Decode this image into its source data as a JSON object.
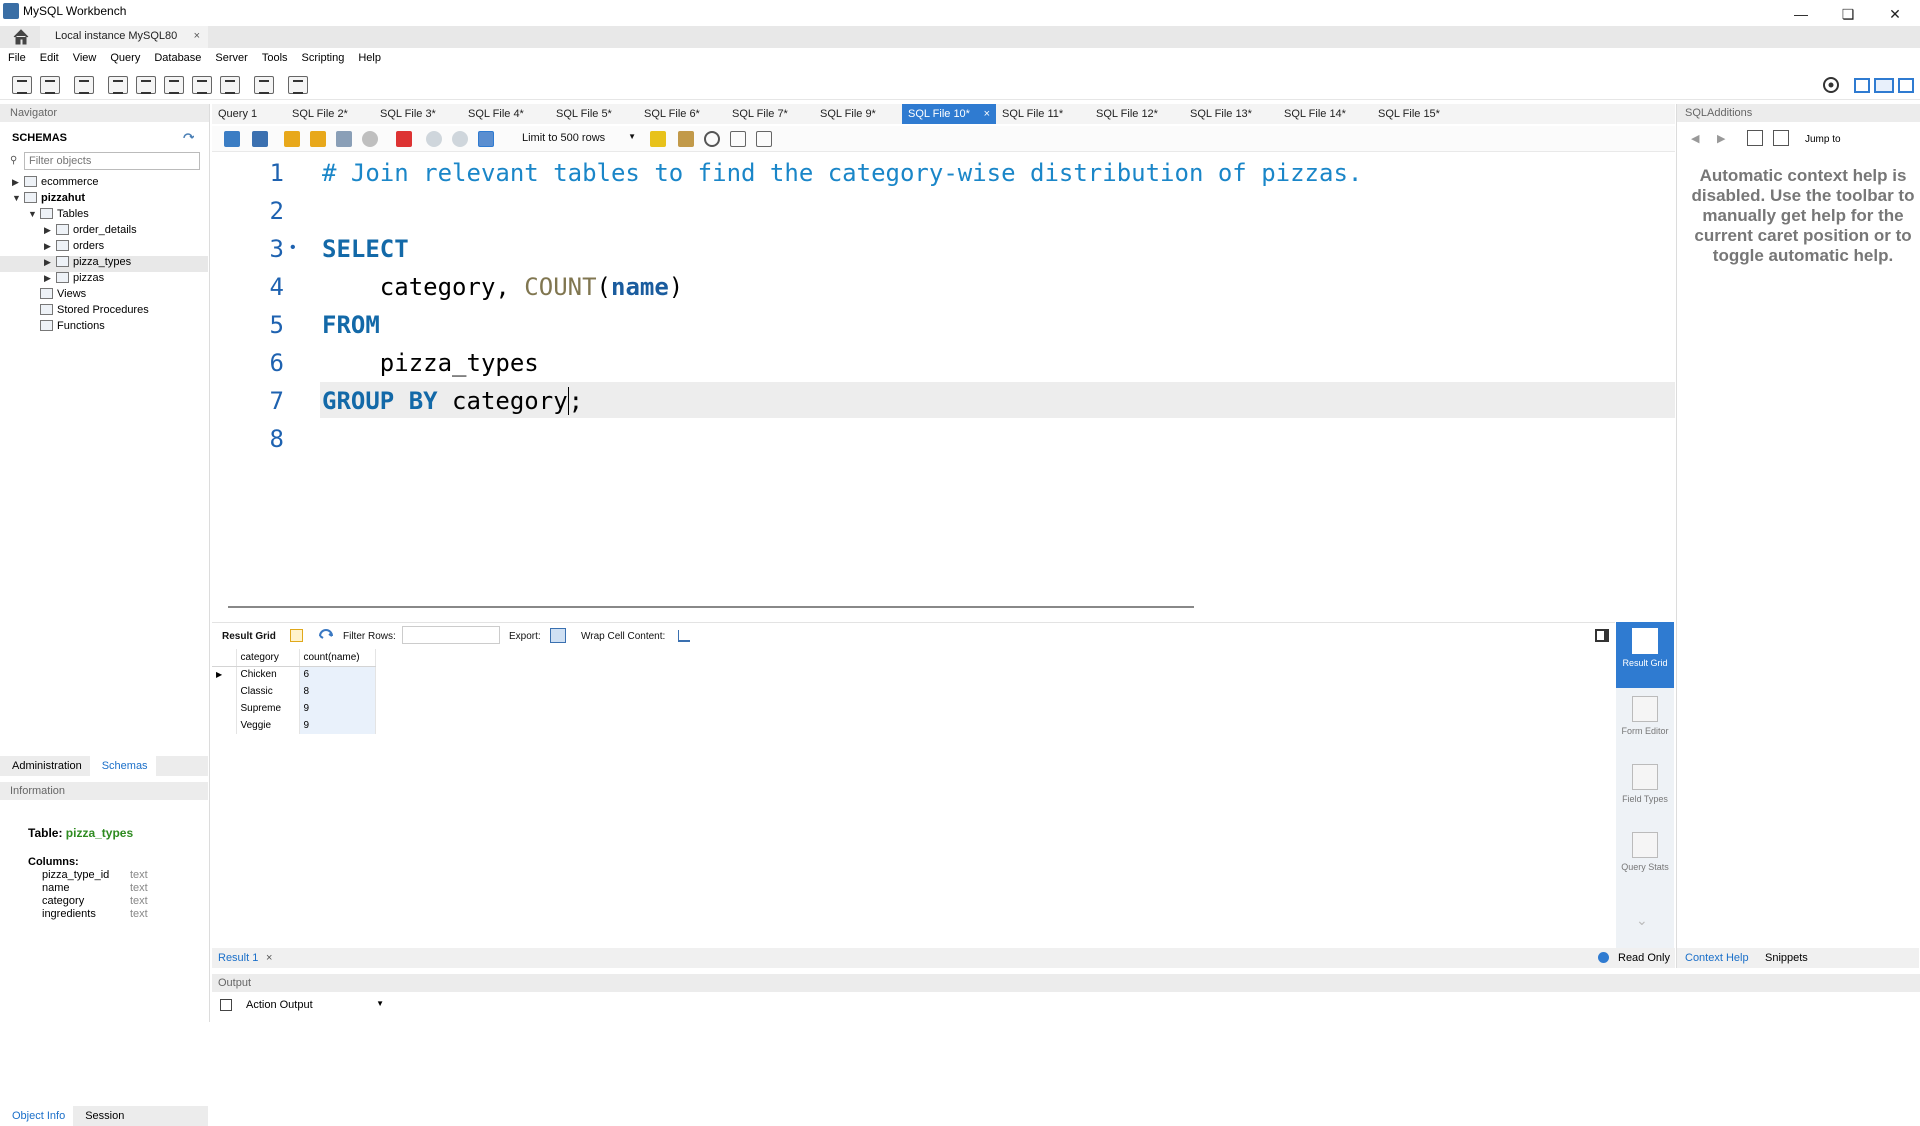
{
  "window": {
    "title": "MySQL Workbench",
    "minimize": "—",
    "restore": "❏",
    "close": "✕"
  },
  "connection_tab": {
    "label": "Local instance MySQL80",
    "close": "×"
  },
  "menu": [
    "File",
    "Edit",
    "View",
    "Query",
    "Database",
    "Server",
    "Tools",
    "Scripting",
    "Help"
  ],
  "navigator": {
    "header": "Navigator",
    "schemas_label": "SCHEMAS",
    "filter_placeholder": "Filter objects",
    "tree": [
      {
        "label": "ecommerce",
        "level": 0,
        "arrow": "▶",
        "bold": false
      },
      {
        "label": "pizzahut",
        "level": 0,
        "arrow": "▼",
        "bold": true
      },
      {
        "label": "Tables",
        "level": 1,
        "arrow": "▼",
        "bold": false
      },
      {
        "label": "order_details",
        "level": 2,
        "arrow": "▶",
        "bold": false
      },
      {
        "label": "orders",
        "level": 2,
        "arrow": "▶",
        "bold": false
      },
      {
        "label": "pizza_types",
        "level": 2,
        "arrow": "▶",
        "bold": false,
        "selected": true
      },
      {
        "label": "pizzas",
        "level": 2,
        "arrow": "▶",
        "bold": false
      },
      {
        "label": "Views",
        "level": 1,
        "arrow": "",
        "bold": false
      },
      {
        "label": "Stored Procedures",
        "level": 1,
        "arrow": "",
        "bold": false
      },
      {
        "label": "Functions",
        "level": 1,
        "arrow": "",
        "bold": false
      }
    ],
    "tabs": [
      "Administration",
      "Schemas"
    ],
    "info_header": "Information",
    "info": {
      "table_prefix": "Table:",
      "table_name": "pizza_types",
      "columns_label": "Columns:",
      "columns": [
        {
          "name": "pizza_type_id",
          "type": "text"
        },
        {
          "name": "name",
          "type": "text"
        },
        {
          "name": "category",
          "type": "text"
        },
        {
          "name": "ingredients",
          "type": "text"
        }
      ]
    },
    "bottom_tabs": [
      "Object Info",
      "Session"
    ]
  },
  "editor_tabs": [
    "Query 1",
    "SQL File 2*",
    "SQL File 3*",
    "SQL File 4*",
    "SQL File 5*",
    "SQL File 6*",
    "SQL File 7*",
    "SQL File 9*",
    "SQL File 10*",
    "SQL File 11*",
    "SQL File 12*",
    "SQL File 13*",
    "SQL File 14*",
    "SQL File 15*"
  ],
  "active_tab": "SQL File 10*",
  "editor_toolbar": {
    "limit": "Limit to 500 rows"
  },
  "code": {
    "line_numbers": [
      "1",
      "2",
      "3",
      "4",
      "5",
      "6",
      "7",
      "8"
    ],
    "statement_marker": "•",
    "comment": "# Join relevant tables to find the category-wise distribution of pizzas.",
    "select_kw": "SELECT",
    "line4_indent": "    category, ",
    "count_fn": "COUNT",
    "paren_open": "(",
    "name_kw": "name",
    "paren_close": ")",
    "from_kw": "FROM",
    "line6": "    pizza_types",
    "group_kw": "GROUP BY",
    "line7_rest": " category",
    "semicolon": ";"
  },
  "result_toolbar": {
    "result_grid": "Result Grid",
    "filter_rows": "Filter Rows:",
    "export": "Export:",
    "wrap": "Wrap Cell Content:"
  },
  "result_grid": {
    "columns": [
      "category",
      "count(name)"
    ],
    "rows": [
      [
        "Chicken",
        "6"
      ],
      [
        "Classic",
        "8"
      ],
      [
        "Supreme",
        "9"
      ],
      [
        "Veggie",
        "9"
      ]
    ]
  },
  "side_tabs": [
    "Result Grid",
    "Form Editor",
    "Field Types",
    "Query Stats"
  ],
  "result_tab": {
    "label": "Result 1",
    "close": "×"
  },
  "read_only": "Read Only",
  "output": {
    "header": "Output",
    "selector": "Action Output"
  },
  "sql_additions": {
    "header": "SQLAdditions",
    "jump_to": "Jump to",
    "help_text": "Automatic context help is disabled. Use the toolbar to manually get help for the current caret position or to toggle automatic help.",
    "tabs": [
      "Context Help",
      "Snippets"
    ]
  },
  "colors": {
    "accent": "#2f7bd1",
    "keyword": "#1369a8",
    "comment": "#1a86c8",
    "table_name": "#2e8b20"
  }
}
